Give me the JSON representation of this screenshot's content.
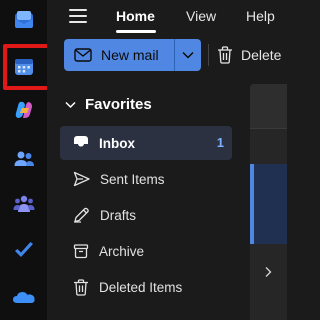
{
  "nav": {
    "tabs": [
      {
        "label": "Home",
        "active": true
      },
      {
        "label": "View",
        "active": false
      },
      {
        "label": "Help",
        "active": false
      }
    ]
  },
  "ribbon": {
    "new_mail_label": "New mail",
    "delete_label": "Delete"
  },
  "favorites": {
    "header": "Favorites",
    "items": [
      {
        "label": "Inbox",
        "count": "1",
        "selected": true,
        "icon": "inbox-icon"
      },
      {
        "label": "Sent Items",
        "selected": false,
        "icon": "send-icon"
      },
      {
        "label": "Drafts",
        "selected": false,
        "icon": "pencil-icon"
      },
      {
        "label": "Archive",
        "selected": false,
        "icon": "archive-icon"
      },
      {
        "label": "Deleted Items",
        "selected": false,
        "icon": "trash-icon"
      }
    ]
  },
  "rail": {
    "apps": [
      "mail-icon",
      "calendar-icon",
      "copilot-icon",
      "people-icon",
      "teams-icon",
      "todo-icon",
      "onedrive-icon"
    ],
    "highlighted": "calendar-icon"
  },
  "colors": {
    "accent": "#4f87e3",
    "highlight_box": "#e01818",
    "background": "#1b1b1b",
    "selected_folder": "#2b3140"
  }
}
